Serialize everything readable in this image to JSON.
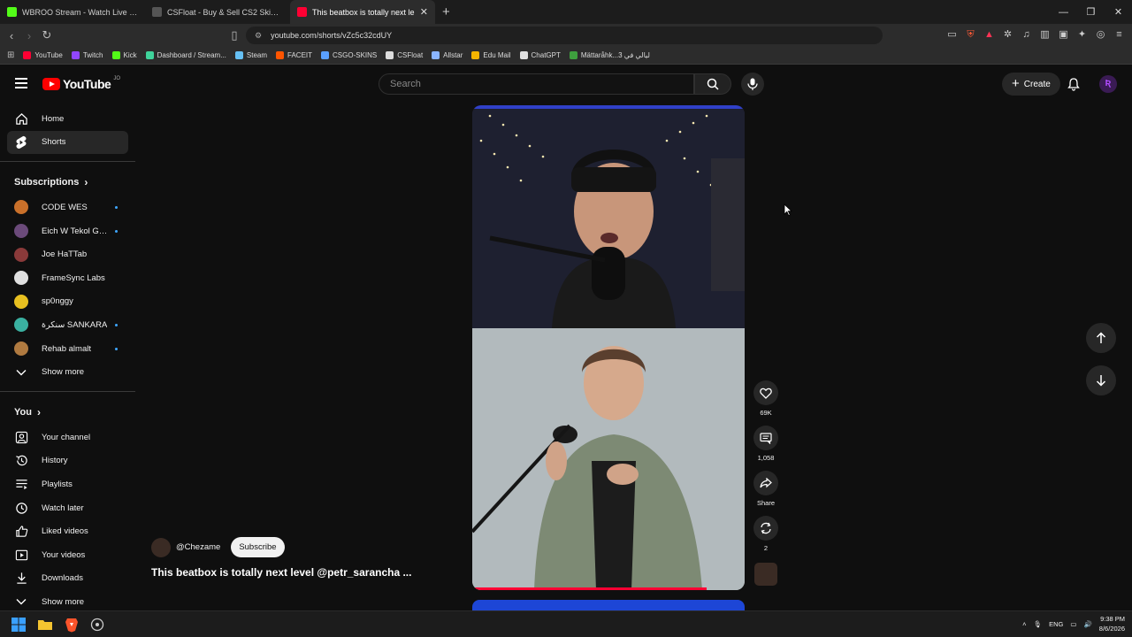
{
  "browser": {
    "tabs": [
      {
        "title": "WBROO Stream - Watch Live on",
        "color": "#53fc18"
      },
      {
        "title": "CSFloat - Buy & Sell CS2 Skins on the",
        "color": "#cccccc"
      },
      {
        "title": "This beatbox is totally next le",
        "color": "#ff0033"
      }
    ],
    "url": "youtube.com/shorts/vZc5c32cdUY",
    "bookmarks": [
      {
        "label": "YouTube",
        "color": "#ff0033"
      },
      {
        "label": "Twitch",
        "color": "#9146ff"
      },
      {
        "label": "Kick",
        "color": "#53fc18"
      },
      {
        "label": "Dashboard / Stream...",
        "color": "#3fd39b"
      },
      {
        "label": "Steam",
        "color": "#66c0f4"
      },
      {
        "label": "FACEIT",
        "color": "#ff5500"
      },
      {
        "label": "CSGO-SKINS",
        "color": "#5aa0ff"
      },
      {
        "label": "CSFloat",
        "color": "#dddddd"
      },
      {
        "label": "Allstar",
        "color": "#8ab4ff"
      },
      {
        "label": "Edu Mail",
        "color": "#f4b400"
      },
      {
        "label": "ChatGPT",
        "color": "#e0e0e0"
      },
      {
        "label": "Mättaråhk...ليالي في 3",
        "color": "#3ea03e"
      }
    ]
  },
  "header": {
    "logo_text": "YouTube",
    "country": "JO",
    "search_placeholder": "Search",
    "create_label": "Create",
    "avatar_letter": "Ʀ"
  },
  "sidebar": {
    "main": [
      {
        "label": "Home",
        "icon": "home-icon"
      },
      {
        "label": "Shorts",
        "icon": "shorts-icon"
      }
    ],
    "subscriptions_title": "Subscriptions",
    "subscriptions": [
      {
        "label": "CODE WES",
        "color": "#c9702a",
        "new": true
      },
      {
        "label": "Eich W Tekol Gh...",
        "color": "#6b4a7a",
        "new": true
      },
      {
        "label": "Joe HaTTab",
        "color": "#8a3a3a",
        "new": false
      },
      {
        "label": "FrameSync Labs",
        "color": "#e0e0e0",
        "new": false
      },
      {
        "label": "sp0nggy",
        "color": "#e8c020",
        "new": false
      },
      {
        "label": "سنكرة SANKARA",
        "color": "#3ab0a0",
        "new": true
      },
      {
        "label": "Rehab almalt",
        "color": "#b07a40",
        "new": true
      }
    ],
    "show_more": "Show more",
    "you_title": "You",
    "you_items": [
      {
        "label": "Your channel",
        "icon": "channel-icon"
      },
      {
        "label": "History",
        "icon": "history-icon"
      },
      {
        "label": "Playlists",
        "icon": "playlists-icon"
      },
      {
        "label": "Watch later",
        "icon": "watch-later-icon"
      },
      {
        "label": "Liked videos",
        "icon": "like-icon"
      },
      {
        "label": "Your videos",
        "icon": "your-videos-icon"
      },
      {
        "label": "Downloads",
        "icon": "download-icon"
      }
    ],
    "show_more_2": "Show more"
  },
  "short": {
    "channel": "@Chezame",
    "subscribe": "Subscribe",
    "title": "This beatbox is totally next level @petr_sarancha  ...",
    "likes": "69K",
    "comments": "1,058",
    "share": "Share",
    "remix": "2",
    "progress": 0.86
  },
  "taskbar": {
    "lang": "ENG",
    "time": "9:38 PM",
    "date": "8/6/2026"
  }
}
